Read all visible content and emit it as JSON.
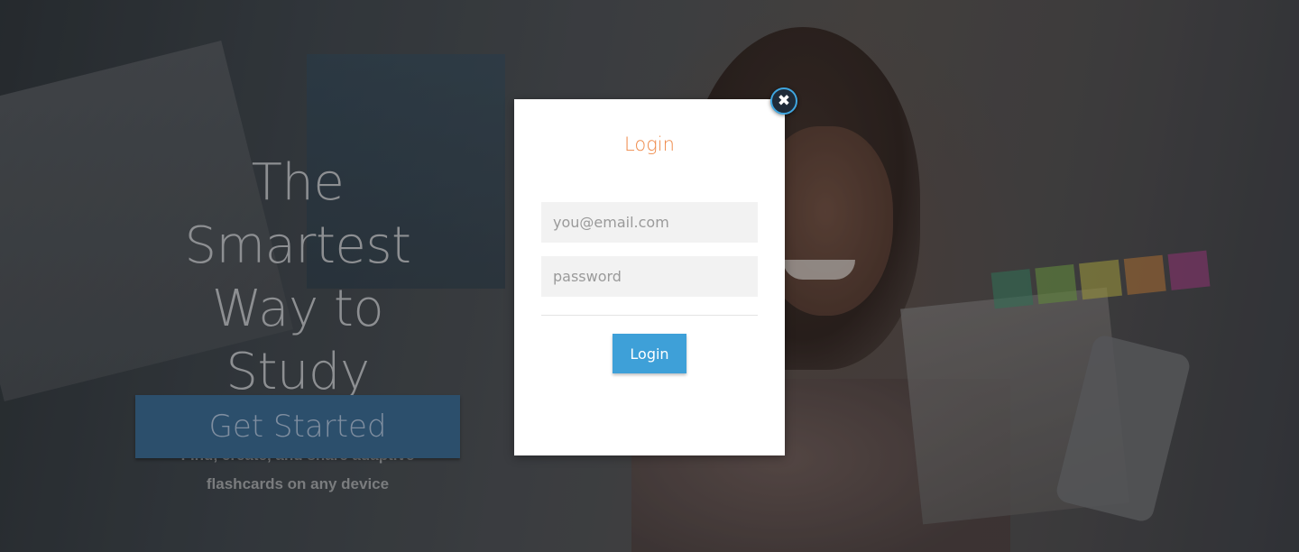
{
  "hero": {
    "title_line1": "The Smartest",
    "title_line2": "Way to Study",
    "subtitle_line1": "Find, create, and share adaptive",
    "subtitle_line2": "flashcards on any device",
    "cta_label": "Get Started"
  },
  "login_modal": {
    "title": "Login",
    "email_placeholder": "you@email.com",
    "password_placeholder": "password",
    "submit_label": "Login",
    "close_icon": "close-icon"
  },
  "colors": {
    "accent_orange": "#ef8a4a",
    "button_blue": "#3ea0d8",
    "cta_blue": "#2c4f6c",
    "input_bg": "#f2f2f2"
  }
}
